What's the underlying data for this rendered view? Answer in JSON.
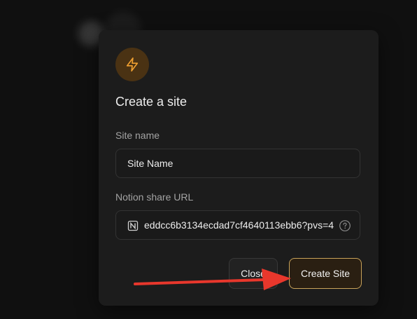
{
  "dialog": {
    "title": "Create a site",
    "site_name": {
      "label": "Site name",
      "value": "Site Name"
    },
    "notion_url": {
      "label": "Notion share URL",
      "value": "eddcc6b3134ecdad7cf4640113ebb6?pvs=4"
    },
    "buttons": {
      "close_label": "Close",
      "create_label": "Create Site"
    }
  },
  "icons": {
    "badge": "lightning-bolt-icon",
    "url_prefix": "notion-logo-icon",
    "help": "question-circle-icon"
  },
  "colors": {
    "accent": "#f0a030",
    "badge_bg": "#4a3213",
    "create_border": "#c9a35a",
    "annotation_arrow": "#e8372c"
  }
}
